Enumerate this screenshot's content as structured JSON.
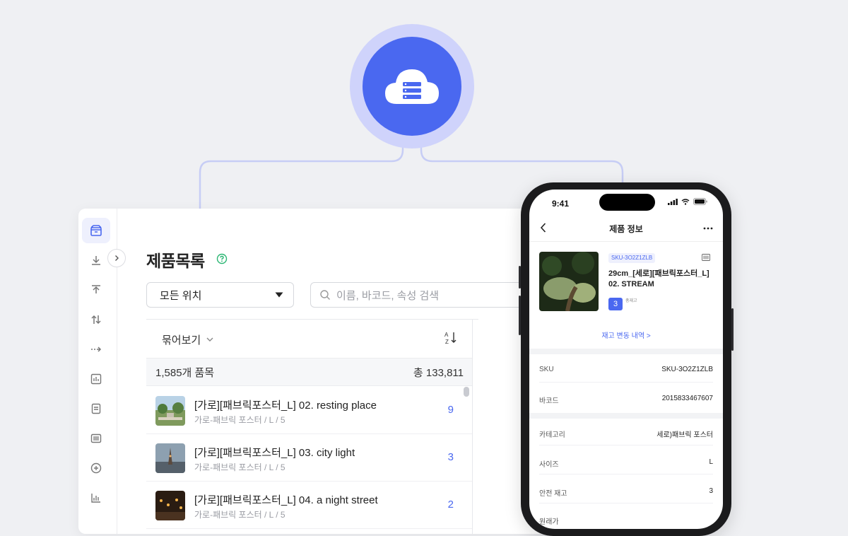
{
  "sidebar": {
    "items": [
      {
        "icon": "box-icon",
        "active": true
      },
      {
        "icon": "download-arrow-icon"
      },
      {
        "icon": "upload-arrow-icon"
      },
      {
        "icon": "swap-arrows-icon"
      },
      {
        "icon": "move-arrow-icon"
      },
      {
        "icon": "chart-box-icon"
      },
      {
        "icon": "document-icon"
      },
      {
        "icon": "barcode-icon"
      },
      {
        "icon": "plus-circle-icon"
      },
      {
        "icon": "bar-chart-icon"
      }
    ]
  },
  "desktop": {
    "title": "제품목록",
    "location_select": "모든 위치",
    "search_placeholder": "이름, 바코드, 속성 검색",
    "group_by_label": "묶어보기",
    "summary_count": "1,585개 품목",
    "summary_total": "총 133,811",
    "products": [
      {
        "name": "[가로][패브릭포스터_L] 02. resting place",
        "sub": "가로-패브릭 포스터 / L / 5",
        "qty": "9",
        "thumb": "park"
      },
      {
        "name": "[가로][패브릭포스터_L] 03. city light",
        "sub": "가로-패브릭 포스터 / L / 5",
        "qty": "3",
        "thumb": "tower"
      },
      {
        "name": "[가로][패브릭포스터_L] 04. a night street",
        "sub": "가로-패브릭 포스터 / L / 5",
        "qty": "2",
        "thumb": "night"
      }
    ]
  },
  "phone": {
    "time": "9:41",
    "nav_title": "제품 정보",
    "sku_chip": "SKU-3O2Z1ZLB",
    "product_name": "29cm_[세로][패브릭포스터_L] 02. STREAM",
    "qty": "3",
    "qty_label": "총재고",
    "history_link": "재고 변동 내역 >",
    "fields": [
      {
        "label": "SKU",
        "value": "SKU-3O2Z1ZLB"
      },
      {
        "label": "바코드",
        "value": "2015833467607"
      },
      {
        "label": "카테고리",
        "value": "세로)패브릭 포스터"
      },
      {
        "label": "사이즈",
        "value": "L"
      },
      {
        "label": "안전 재고",
        "value": "3"
      },
      {
        "label": "원래가",
        "value": ""
      }
    ]
  },
  "colors": {
    "accent": "#4a68f0",
    "background": "#eff0f3"
  }
}
